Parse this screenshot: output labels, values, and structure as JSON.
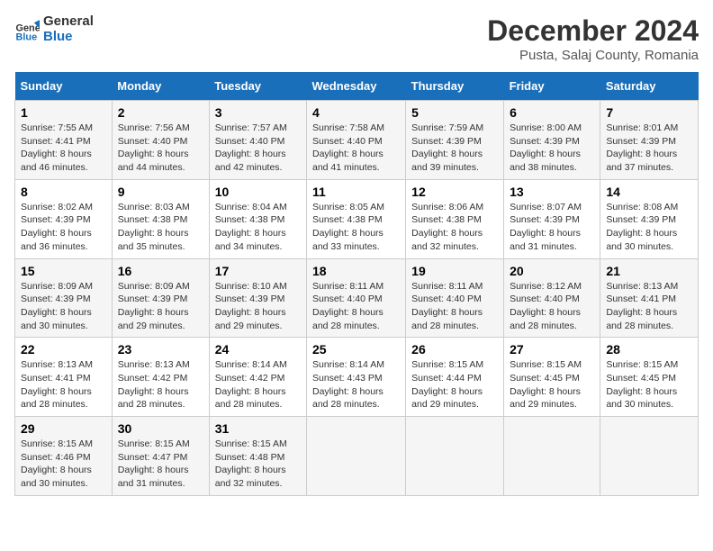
{
  "logo": {
    "line1": "General",
    "line2": "Blue"
  },
  "title": "December 2024",
  "subtitle": "Pusta, Salaj County, Romania",
  "days_of_week": [
    "Sunday",
    "Monday",
    "Tuesday",
    "Wednesday",
    "Thursday",
    "Friday",
    "Saturday"
  ],
  "weeks": [
    [
      {
        "day": "1",
        "sunrise": "7:55 AM",
        "sunset": "4:41 PM",
        "daylight": "8 hours and 46 minutes."
      },
      {
        "day": "2",
        "sunrise": "7:56 AM",
        "sunset": "4:40 PM",
        "daylight": "8 hours and 44 minutes."
      },
      {
        "day": "3",
        "sunrise": "7:57 AM",
        "sunset": "4:40 PM",
        "daylight": "8 hours and 42 minutes."
      },
      {
        "day": "4",
        "sunrise": "7:58 AM",
        "sunset": "4:40 PM",
        "daylight": "8 hours and 41 minutes."
      },
      {
        "day": "5",
        "sunrise": "7:59 AM",
        "sunset": "4:39 PM",
        "daylight": "8 hours and 39 minutes."
      },
      {
        "day": "6",
        "sunrise": "8:00 AM",
        "sunset": "4:39 PM",
        "daylight": "8 hours and 38 minutes."
      },
      {
        "day": "7",
        "sunrise": "8:01 AM",
        "sunset": "4:39 PM",
        "daylight": "8 hours and 37 minutes."
      }
    ],
    [
      {
        "day": "8",
        "sunrise": "8:02 AM",
        "sunset": "4:39 PM",
        "daylight": "8 hours and 36 minutes."
      },
      {
        "day": "9",
        "sunrise": "8:03 AM",
        "sunset": "4:38 PM",
        "daylight": "8 hours and 35 minutes."
      },
      {
        "day": "10",
        "sunrise": "8:04 AM",
        "sunset": "4:38 PM",
        "daylight": "8 hours and 34 minutes."
      },
      {
        "day": "11",
        "sunrise": "8:05 AM",
        "sunset": "4:38 PM",
        "daylight": "8 hours and 33 minutes."
      },
      {
        "day": "12",
        "sunrise": "8:06 AM",
        "sunset": "4:38 PM",
        "daylight": "8 hours and 32 minutes."
      },
      {
        "day": "13",
        "sunrise": "8:07 AM",
        "sunset": "4:39 PM",
        "daylight": "8 hours and 31 minutes."
      },
      {
        "day": "14",
        "sunrise": "8:08 AM",
        "sunset": "4:39 PM",
        "daylight": "8 hours and 30 minutes."
      }
    ],
    [
      {
        "day": "15",
        "sunrise": "8:09 AM",
        "sunset": "4:39 PM",
        "daylight": "8 hours and 30 minutes."
      },
      {
        "day": "16",
        "sunrise": "8:09 AM",
        "sunset": "4:39 PM",
        "daylight": "8 hours and 29 minutes."
      },
      {
        "day": "17",
        "sunrise": "8:10 AM",
        "sunset": "4:39 PM",
        "daylight": "8 hours and 29 minutes."
      },
      {
        "day": "18",
        "sunrise": "8:11 AM",
        "sunset": "4:40 PM",
        "daylight": "8 hours and 28 minutes."
      },
      {
        "day": "19",
        "sunrise": "8:11 AM",
        "sunset": "4:40 PM",
        "daylight": "8 hours and 28 minutes."
      },
      {
        "day": "20",
        "sunrise": "8:12 AM",
        "sunset": "4:40 PM",
        "daylight": "8 hours and 28 minutes."
      },
      {
        "day": "21",
        "sunrise": "8:13 AM",
        "sunset": "4:41 PM",
        "daylight": "8 hours and 28 minutes."
      }
    ],
    [
      {
        "day": "22",
        "sunrise": "8:13 AM",
        "sunset": "4:41 PM",
        "daylight": "8 hours and 28 minutes."
      },
      {
        "day": "23",
        "sunrise": "8:13 AM",
        "sunset": "4:42 PM",
        "daylight": "8 hours and 28 minutes."
      },
      {
        "day": "24",
        "sunrise": "8:14 AM",
        "sunset": "4:42 PM",
        "daylight": "8 hours and 28 minutes."
      },
      {
        "day": "25",
        "sunrise": "8:14 AM",
        "sunset": "4:43 PM",
        "daylight": "8 hours and 28 minutes."
      },
      {
        "day": "26",
        "sunrise": "8:15 AM",
        "sunset": "4:44 PM",
        "daylight": "8 hours and 29 minutes."
      },
      {
        "day": "27",
        "sunrise": "8:15 AM",
        "sunset": "4:45 PM",
        "daylight": "8 hours and 29 minutes."
      },
      {
        "day": "28",
        "sunrise": "8:15 AM",
        "sunset": "4:45 PM",
        "daylight": "8 hours and 30 minutes."
      }
    ],
    [
      {
        "day": "29",
        "sunrise": "8:15 AM",
        "sunset": "4:46 PM",
        "daylight": "8 hours and 30 minutes."
      },
      {
        "day": "30",
        "sunrise": "8:15 AM",
        "sunset": "4:47 PM",
        "daylight": "8 hours and 31 minutes."
      },
      {
        "day": "31",
        "sunrise": "8:15 AM",
        "sunset": "4:48 PM",
        "daylight": "8 hours and 32 minutes."
      },
      null,
      null,
      null,
      null
    ]
  ]
}
